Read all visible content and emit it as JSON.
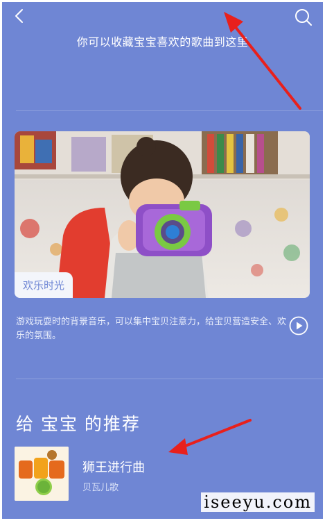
{
  "header": {
    "back_icon": "chevron-left-icon",
    "search_icon": "search-icon",
    "text": "你可以收藏宝宝喜欢的歌曲到这里"
  },
  "featured": {
    "tag": "欢乐时光",
    "description": "游戏玩耍时的背景音乐，可以集中宝贝注意力，给宝贝营造安全、欢乐的氛围。",
    "play_icon": "play-circle-icon"
  },
  "recommend": {
    "title": "给 宝宝 的推荐",
    "items": [
      {
        "title": "狮王进行曲",
        "subtitle": "贝瓦儿歌",
        "cover_icon": "beva-erge-logo"
      }
    ]
  },
  "watermark": "iseeyu.com",
  "colors": {
    "background": "#6f86d4",
    "text": "#ffffff",
    "annotation_arrow": "#e8201c"
  }
}
